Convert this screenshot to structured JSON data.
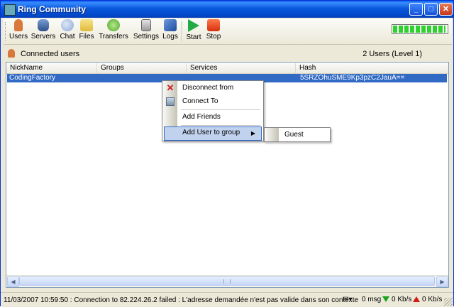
{
  "window": {
    "title": "Ring Community",
    "minimize_glyph": "_",
    "maximize_glyph": "□",
    "close_glyph": "✕"
  },
  "toolbar": {
    "buttons": [
      {
        "label": "Users",
        "icon": "users-icon",
        "color": "#d9783b"
      },
      {
        "label": "Servers",
        "icon": "servers-icon",
        "color": "#4a6fa8"
      },
      {
        "label": "Chat",
        "icon": "chat-icon",
        "color": "#8aa6d6"
      },
      {
        "label": "Files",
        "icon": "files-icon",
        "color": "#e8c84a"
      },
      {
        "label": "Transfers",
        "icon": "transfers-icon",
        "color": "#6cc04a"
      },
      {
        "label": "Settings",
        "icon": "settings-icon",
        "color": "#9a9a9a"
      },
      {
        "label": "Logs",
        "icon": "logs-icon",
        "color": "#2f5fb0"
      }
    ],
    "start": {
      "label": "Start",
      "icon": "start-icon",
      "color": "#22aa44"
    },
    "stop": {
      "label": "Stop",
      "icon": "stop-icon",
      "color": "#e8461e"
    },
    "connection_progress": 0.98
  },
  "header": {
    "title": "Connected users",
    "count": "2 Users (Level 1)"
  },
  "table": {
    "columns": [
      "NickName",
      "Groups",
      "Services",
      "Hash"
    ],
    "rows": [
      {
        "nickname": "CodingFactory",
        "groups": "",
        "services": "",
        "hash": "5SRZOhuSME9Kp3pzC2JauA=="
      }
    ]
  },
  "context_menu": {
    "items": [
      {
        "label": "Disconnect from",
        "icon": "disconnect-icon"
      },
      {
        "label": "Connect To",
        "icon": "connect-icon"
      },
      {
        "label": "Add Friends",
        "icon": ""
      },
      {
        "label": "Add User to group",
        "icon": ""
      }
    ],
    "submenu": {
      "items": [
        {
          "label": "Guest"
        }
      ]
    }
  },
  "statusbar": {
    "message": "11/03/2007 10:59:50 : Connection to 82.224.26.2 failed : L'adresse demandée n'est pas valide dans son contexte",
    "msg_count": "0 msg",
    "download_rate": "0 Kb/s",
    "upload_rate": "0 Kb/s"
  }
}
